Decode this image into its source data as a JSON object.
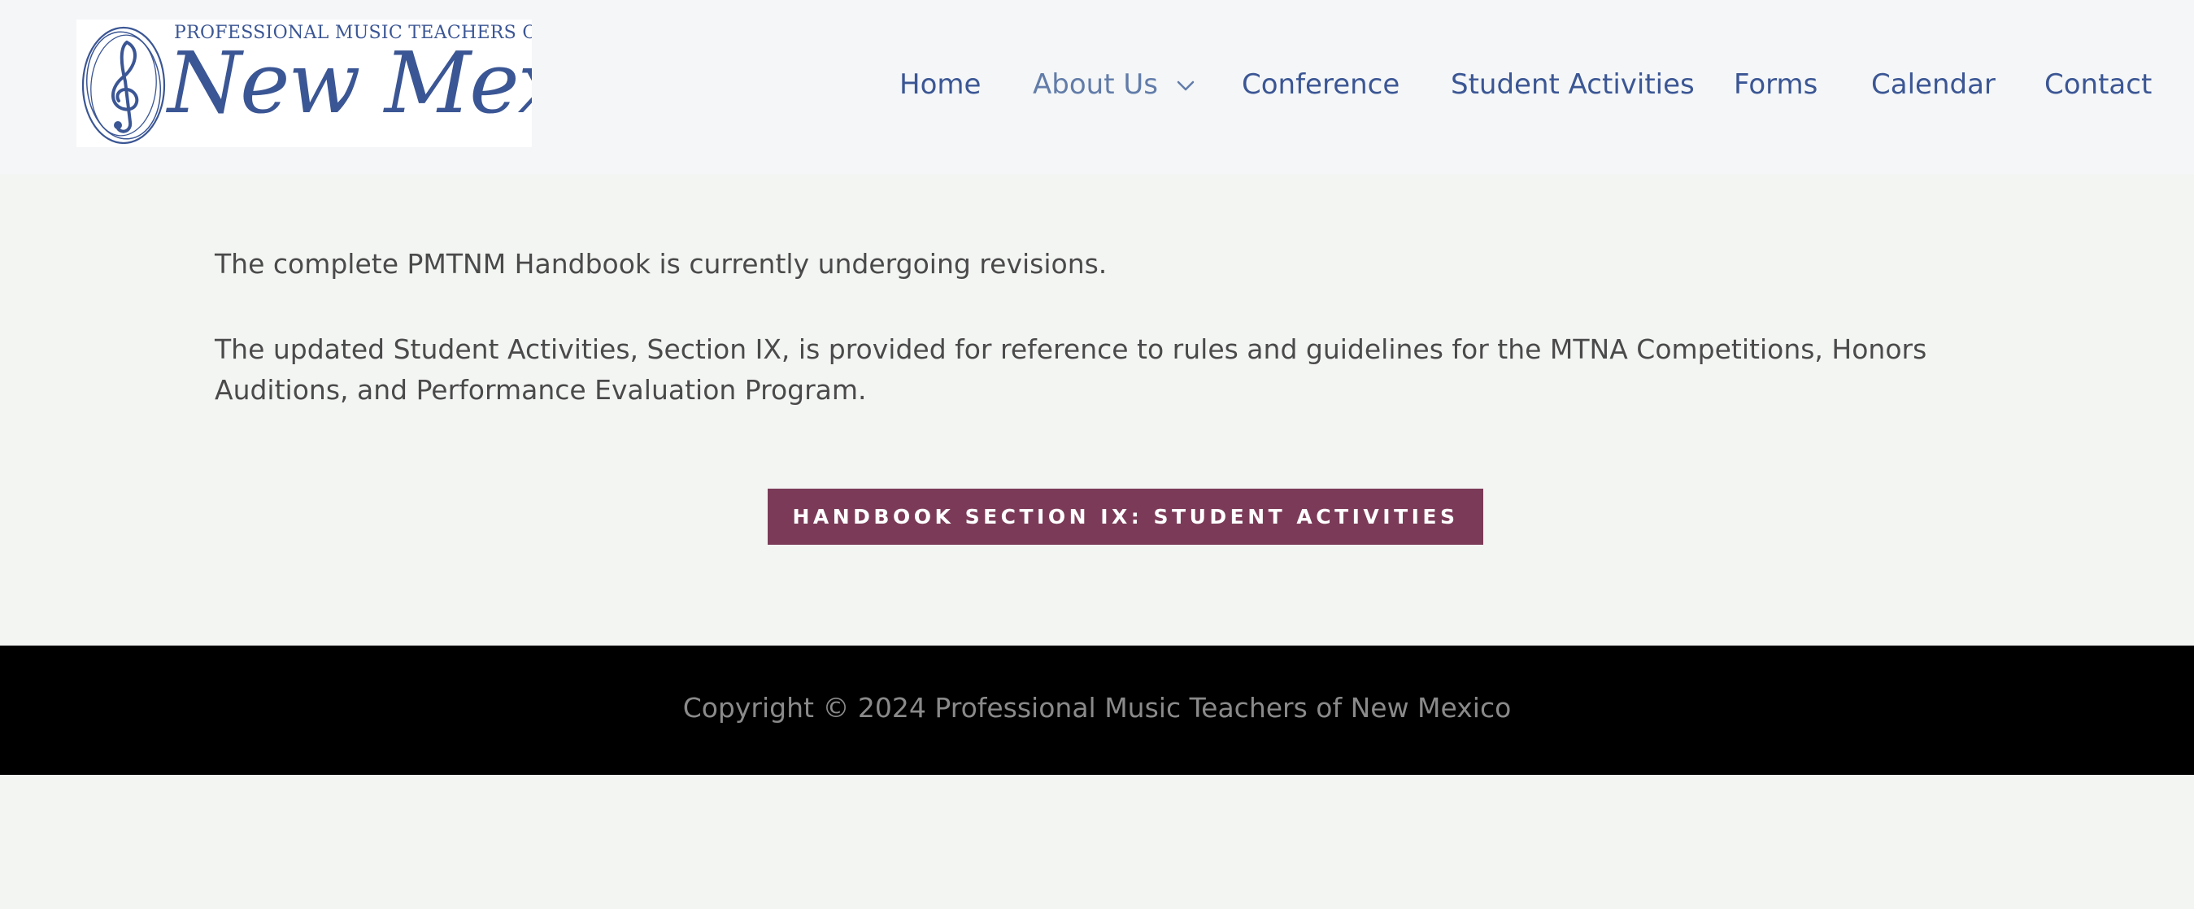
{
  "header": {
    "logo": {
      "org_line": "PROFESSIONAL MUSIC TEACHERS OF",
      "state_script": "New Mexico",
      "icon": "treble-clef-icon",
      "color": "#3b5694"
    },
    "nav": [
      {
        "label": "Home"
      },
      {
        "label": "About Us",
        "icon": "chevron-down-icon",
        "active": true
      },
      {
        "label": "Conference"
      },
      {
        "label": "Student Activities"
      },
      {
        "label": "Forms"
      },
      {
        "label": "Calendar"
      },
      {
        "label": "Contact"
      }
    ]
  },
  "main": {
    "paragraphs": [
      "The complete PMTNM Handbook is currently undergoing revisions.",
      "The updated Student Activities, Section IX, is provided for reference to rules and guidelines for the MTNA Competitions, Honors Auditions, and Performance Evaluation Program."
    ],
    "button_label": "HANDBOOK SECTION IX: STUDENT ACTIVITIES"
  },
  "footer": {
    "copyright": "Copyright © 2024 Professional Music Teachers of New Mexico"
  },
  "colors": {
    "nav_link": "#3b5694",
    "nav_active": "#627ca9",
    "button_bg": "#7b3b58",
    "footer_bg": "#000000",
    "page_bg": "#f3f5f3"
  }
}
